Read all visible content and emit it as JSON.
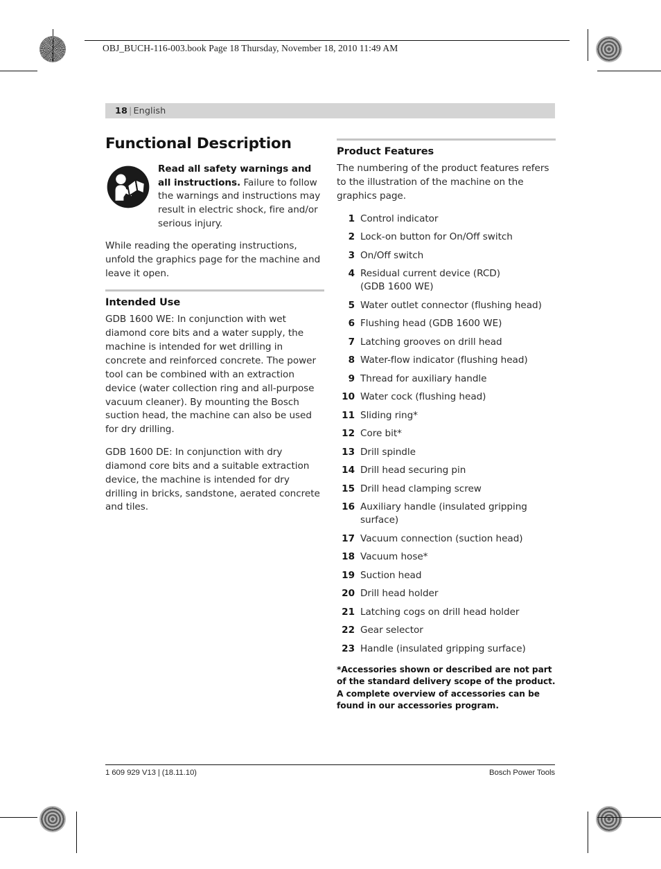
{
  "print_meta": {
    "book_line": "OBJ_BUCH-116-003.book  Page 18  Thursday, November 18, 2010  11:49 AM"
  },
  "page_header": {
    "page_number": "18",
    "separator": "|",
    "language": "English"
  },
  "left_column": {
    "section_title": "Functional Description",
    "safety_notice": {
      "icon": "read-manual-icon",
      "lead": "Read all safety warnings and all instructions.",
      "rest": " Failure to follow the warnings and instructions may result in electric shock, fire and/or serious injury."
    },
    "unfold_paragraph": "While reading the operating instructions, unfold the graphics page for the machine and leave it open.",
    "intended_use": {
      "heading": "Intended Use",
      "paragraphs": [
        "GDB 1600 WE: In conjunction with wet diamond core bits and a water supply, the machine is intended for wet drilling in concrete and reinforced concrete. The power tool can be combined with an extraction device (water collection ring and all-purpose vacuum cleaner). By mounting the Bosch suction head, the machine can also be used for dry drilling.",
        "GDB 1600 DE: In conjunction with dry diamond core bits and a suitable extraction device, the machine is intended for dry drilling in bricks, sandstone, aerated concrete and tiles."
      ]
    }
  },
  "right_column": {
    "heading": "Product Features",
    "intro": "The numbering of the product features refers to the illustration of the machine on the graphics page.",
    "features": [
      {
        "num": "1",
        "label": "Control indicator"
      },
      {
        "num": "2",
        "label": "Lock-on button for On/Off switch"
      },
      {
        "num": "3",
        "label": "On/Off switch"
      },
      {
        "num": "4",
        "label": "Residual current device (RCD)",
        "sub": "(GDB 1600 WE)"
      },
      {
        "num": "5",
        "label": "Water outlet connector  (flushing head)"
      },
      {
        "num": "6",
        "label": "Flushing head  (GDB 1600 WE)"
      },
      {
        "num": "7",
        "label": "Latching grooves on drill head"
      },
      {
        "num": "8",
        "label": "Water-flow indicator  (flushing head)"
      },
      {
        "num": "9",
        "label": "Thread for auxiliary handle"
      },
      {
        "num": "10",
        "label": "Water cock  (flushing head)"
      },
      {
        "num": "11",
        "label": "Sliding ring*"
      },
      {
        "num": "12",
        "label": "Core bit*"
      },
      {
        "num": "13",
        "label": "Drill spindle"
      },
      {
        "num": "14",
        "label": "Drill head securing pin"
      },
      {
        "num": "15",
        "label": "Drill head clamping screw"
      },
      {
        "num": "16",
        "label": "Auxiliary handle (insulated gripping surface)"
      },
      {
        "num": "17",
        "label": "Vacuum connection  (suction head)"
      },
      {
        "num": "18",
        "label": "Vacuum hose*"
      },
      {
        "num": "19",
        "label": "Suction head"
      },
      {
        "num": "20",
        "label": "Drill head holder"
      },
      {
        "num": "21",
        "label": "Latching cogs on drill head holder"
      },
      {
        "num": "22",
        "label": "Gear selector"
      },
      {
        "num": "23",
        "label": "Handle (insulated gripping surface)"
      }
    ],
    "footnote": "*Accessories shown or described are not part of the standard delivery scope of the product. A complete overview of accessories can be found in our accessories program."
  },
  "page_footer": {
    "left": "1 609 929 V13 | (18.11.10)",
    "right": "Bosch Power Tools"
  },
  "colors": {
    "header_bar": "#d4d4d4",
    "rule_gray": "#c5c5c5",
    "text": "#2a2a2a",
    "heading": "#141414"
  }
}
